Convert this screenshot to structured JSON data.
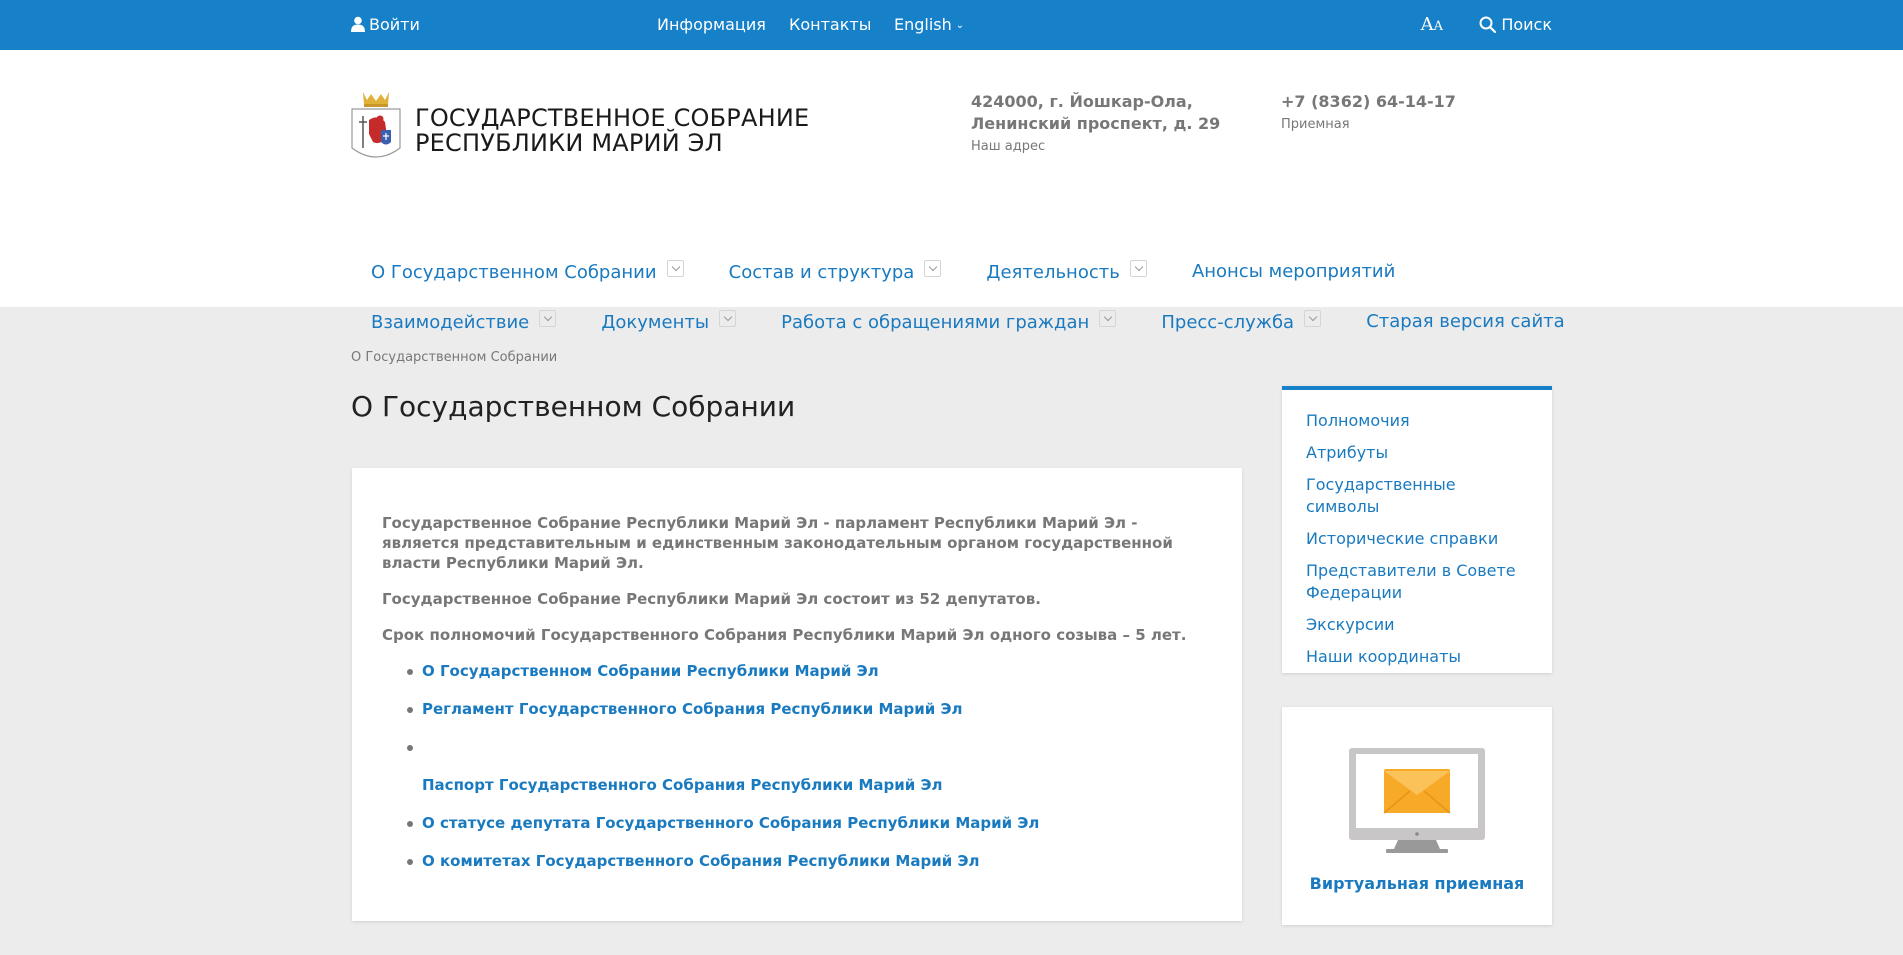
{
  "topbar": {
    "login": "Войти",
    "info": "Информация",
    "contacts": "Контакты",
    "language": "English",
    "font_big": "A",
    "font_small": "A",
    "search": "Поиск"
  },
  "header": {
    "title_line1": "ГОСУДАРСТВЕННОЕ СОБРАНИЕ",
    "title_line2": "РЕСПУБЛИКИ МАРИЙ ЭЛ",
    "address_line1": "424000, г. Йошкар-Ола,",
    "address_line2": "Ленинский проспект, д. 29",
    "address_caption": "Наш адрес",
    "phone": "+7 (8362) 64-14-17",
    "phone_caption": "Приемная"
  },
  "nav": {
    "row1": [
      {
        "label": "О Государственном Собрании",
        "dropdown": true
      },
      {
        "label": "Состав и структура",
        "dropdown": true
      },
      {
        "label": "Деятельность",
        "dropdown": true
      },
      {
        "label": "Анонсы мероприятий",
        "dropdown": false
      }
    ],
    "row2": [
      {
        "label": "Взаимодейcтвие",
        "dropdown": true
      },
      {
        "label": "Документы",
        "dropdown": true
      },
      {
        "label": "Работа с обращениями граждан",
        "dropdown": true
      },
      {
        "label": "Пресс-служба",
        "dropdown": true
      },
      {
        "label": "Старая версия сайта",
        "dropdown": false
      }
    ]
  },
  "breadcrumb": "О Государственном Собрании",
  "page_title": "О Государственном Собрании",
  "main": {
    "paragraphs": [
      "Государственное Собрание Республики Марий Эл - парламент Республики Марий Эл - является представительным и единственным законодательным органом государственной власти Республики Марий Эл.",
      "Государственное Собрание Республики Марий Эл состоит из 52 депутатов.",
      "Срок полномочий Государственного Собрания Республики Марий Эл одного созыва – 5 лет."
    ],
    "links": [
      "О Государственном Собрании Республики Марий Эл",
      "Регламент Государственного Собрания Республики Марий Эл",
      "Паспорт Государственного Собрания Республики Марий Эл",
      "О статусе депутата Государственного Собрания Республики Марий Эл",
      "О комитетах Государственного Собрания Республики Марий Эл"
    ]
  },
  "side_menu": [
    "Полномочия",
    "Атрибуты",
    "Государственные символы",
    "Исторические справки",
    "Представители в Совете Федерации",
    "Экскурсии",
    "Наши координаты"
  ],
  "side_card": {
    "caption": "Виртуальная приемная",
    "icon": "monitor-envelope-icon"
  },
  "colors": {
    "topbar": "#1680c8",
    "link": "#1a7ac0",
    "background": "#ececec",
    "envelope": "#f7a928"
  }
}
